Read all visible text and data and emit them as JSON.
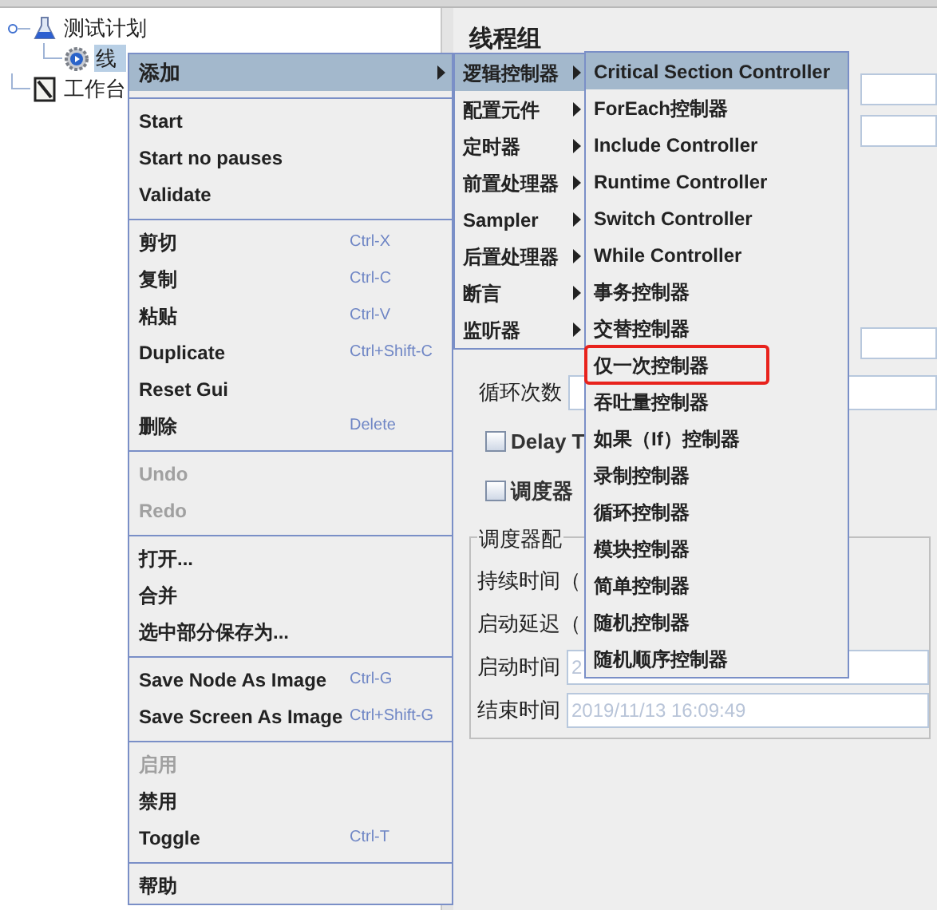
{
  "tree": [
    {
      "label": "测试计划",
      "kind": "plan",
      "selected": false,
      "children": [
        {
          "label": "线",
          "kind": "thread",
          "selected": true
        }
      ]
    },
    {
      "label": "工作台",
      "kind": "workbench",
      "selected": false
    }
  ],
  "panel": {
    "title": "线程组",
    "loop_label": "循环次数",
    "delay_checkbox": {
      "label": "Delay T",
      "checked": false
    },
    "scheduler_checkbox": {
      "label": "调度器",
      "checked": false
    },
    "scheduler_group": "调度器配",
    "duration_label": "持续时间（",
    "delay_label": "启动延迟（",
    "start_label": "启动时间",
    "start_value": "2",
    "end_label": "结束时间",
    "end_value": "2019/11/13 16:09:49"
  },
  "context_menu": [
    {
      "kind": "item",
      "label": "添加",
      "selected": true,
      "submenu": true,
      "disabled": false
    },
    {
      "kind": "separator"
    },
    {
      "kind": "item",
      "label": "Start",
      "selected": false,
      "submenu": false,
      "disabled": false
    },
    {
      "kind": "item",
      "label": "Start no pauses",
      "selected": false,
      "submenu": false,
      "disabled": false
    },
    {
      "kind": "item",
      "label": "Validate",
      "selected": false,
      "submenu": false,
      "disabled": false
    },
    {
      "kind": "separator"
    },
    {
      "kind": "item",
      "label": "剪切",
      "shortcut": "Ctrl-X",
      "selected": false,
      "submenu": false,
      "disabled": false
    },
    {
      "kind": "item",
      "label": "复制",
      "shortcut": "Ctrl-C",
      "selected": false,
      "submenu": false,
      "disabled": false
    },
    {
      "kind": "item",
      "label": "粘贴",
      "shortcut": "Ctrl-V",
      "selected": false,
      "submenu": false,
      "disabled": false
    },
    {
      "kind": "item",
      "label": "Duplicate",
      "shortcut": "Ctrl+Shift-C",
      "selected": false,
      "submenu": false,
      "disabled": false
    },
    {
      "kind": "item",
      "label": "Reset Gui",
      "selected": false,
      "submenu": false,
      "disabled": false
    },
    {
      "kind": "item",
      "label": "删除",
      "shortcut": "Delete",
      "selected": false,
      "submenu": false,
      "disabled": false
    },
    {
      "kind": "separator"
    },
    {
      "kind": "item",
      "label": "Undo",
      "selected": false,
      "submenu": false,
      "disabled": true
    },
    {
      "kind": "item",
      "label": "Redo",
      "selected": false,
      "submenu": false,
      "disabled": true
    },
    {
      "kind": "separator"
    },
    {
      "kind": "item",
      "label": "打开...",
      "selected": false,
      "submenu": false,
      "disabled": false
    },
    {
      "kind": "item",
      "label": "合并",
      "selected": false,
      "submenu": false,
      "disabled": false
    },
    {
      "kind": "item",
      "label": "选中部分保存为...",
      "selected": false,
      "submenu": false,
      "disabled": false
    },
    {
      "kind": "separator"
    },
    {
      "kind": "item",
      "label": "Save Node As Image",
      "shortcut": "Ctrl-G",
      "selected": false,
      "submenu": false,
      "disabled": false
    },
    {
      "kind": "item",
      "label": "Save Screen As Image",
      "shortcut": "Ctrl+Shift-G",
      "selected": false,
      "submenu": false,
      "disabled": false
    },
    {
      "kind": "separator"
    },
    {
      "kind": "item",
      "label": "启用",
      "selected": false,
      "submenu": false,
      "disabled": true
    },
    {
      "kind": "item",
      "label": "禁用",
      "selected": false,
      "submenu": false,
      "disabled": false
    },
    {
      "kind": "item",
      "label": "Toggle",
      "shortcut": "Ctrl-T",
      "selected": false,
      "submenu": false,
      "disabled": false
    },
    {
      "kind": "separator"
    },
    {
      "kind": "item",
      "label": "帮助",
      "selected": false,
      "submenu": false,
      "disabled": false
    }
  ],
  "add_submenu": [
    {
      "label": "逻辑控制器",
      "selected": true
    },
    {
      "label": "配置元件",
      "selected": false
    },
    {
      "label": "定时器",
      "selected": false
    },
    {
      "label": "前置处理器",
      "selected": false
    },
    {
      "label": "Sampler",
      "selected": false
    },
    {
      "label": "后置处理器",
      "selected": false
    },
    {
      "label": "断言",
      "selected": false
    },
    {
      "label": "监听器",
      "selected": false
    }
  ],
  "controller_submenu": [
    {
      "label": "Critical Section Controller",
      "selected": true,
      "outlined": false
    },
    {
      "label": "ForEach控制器",
      "selected": false,
      "outlined": false
    },
    {
      "label": "Include Controller",
      "selected": false,
      "outlined": false
    },
    {
      "label": "Runtime Controller",
      "selected": false,
      "outlined": false
    },
    {
      "label": "Switch Controller",
      "selected": false,
      "outlined": false
    },
    {
      "label": "While Controller",
      "selected": false,
      "outlined": false
    },
    {
      "label": "事务控制器",
      "selected": false,
      "outlined": false
    },
    {
      "label": "交替控制器",
      "selected": false,
      "outlined": false
    },
    {
      "label": "仅一次控制器",
      "selected": false,
      "outlined": true
    },
    {
      "label": "吞吐量控制器",
      "selected": false,
      "outlined": false
    },
    {
      "label": "如果（If）控制器",
      "selected": false,
      "outlined": false
    },
    {
      "label": "录制控制器",
      "selected": false,
      "outlined": false
    },
    {
      "label": "循环控制器",
      "selected": false,
      "outlined": false
    },
    {
      "label": "模块控制器",
      "selected": false,
      "outlined": false
    },
    {
      "label": "简单控制器",
      "selected": false,
      "outlined": false
    },
    {
      "label": "随机控制器",
      "selected": false,
      "outlined": false
    },
    {
      "label": "随机顺序控制器",
      "selected": false,
      "outlined": false
    }
  ]
}
